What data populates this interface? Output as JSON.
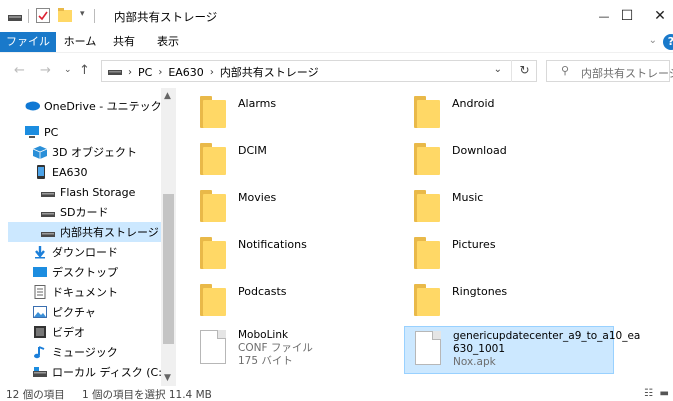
{
  "window": {
    "title": "内部共有ストレージ",
    "minimize": "—",
    "maximize": "☐",
    "close": "✕"
  },
  "ribbon": {
    "tabs": [
      "ファイル",
      "ホーム",
      "共有",
      "表示"
    ]
  },
  "address": {
    "crumbs": [
      "PC",
      "EA630",
      "内部共有ストレージ"
    ],
    "search_placeholder": "内部共有ストレージ..."
  },
  "nav_pane": {
    "items": [
      {
        "label": "OneDrive - ユニテック・ジャパ",
        "icon": "cloud-icon"
      },
      {
        "label": "PC",
        "icon": "pc-icon"
      },
      {
        "label": "3D オブジェクト",
        "icon": "3d-objects-icon"
      },
      {
        "label": "EA630",
        "icon": "phone-icon"
      },
      {
        "label": "Flash Storage",
        "icon": "drive-icon"
      },
      {
        "label": "SDカード",
        "icon": "drive-icon"
      },
      {
        "label": "内部共有ストレージ",
        "icon": "drive-icon",
        "selected": true
      },
      {
        "label": "ダウンロード",
        "icon": "download-icon"
      },
      {
        "label": "デスクトップ",
        "icon": "desktop-icon"
      },
      {
        "label": "ドキュメント",
        "icon": "documents-icon"
      },
      {
        "label": "ピクチャ",
        "icon": "pictures-icon"
      },
      {
        "label": "ビデオ",
        "icon": "video-icon"
      },
      {
        "label": "ミュージック",
        "icon": "music-icon"
      },
      {
        "label": "ローカル ディスク (C:)",
        "icon": "disk-icon"
      }
    ]
  },
  "content": {
    "folders": [
      {
        "name": "Alarms"
      },
      {
        "name": "Android"
      },
      {
        "name": "DCIM"
      },
      {
        "name": "Download"
      },
      {
        "name": "Movies"
      },
      {
        "name": "Music"
      },
      {
        "name": "Notifications"
      },
      {
        "name": "Pictures"
      },
      {
        "name": "Podcasts"
      },
      {
        "name": "Ringtones"
      }
    ],
    "files": [
      {
        "line1": "MoboLink",
        "line2": "CONF ファイル",
        "line3": "175 バイト"
      },
      {
        "line1": "genericupdatecenter_a9_to_a10_ea",
        "line2": "630_1001",
        "line3": "Nox.apk",
        "selected": true
      }
    ]
  },
  "status": {
    "count": "12 個の項目",
    "selected": "1 個の項目を選択  11.4 MB"
  },
  "colors": {
    "accent": "#1979ca",
    "selection": "#cce8ff",
    "folder": "#ffd866"
  }
}
